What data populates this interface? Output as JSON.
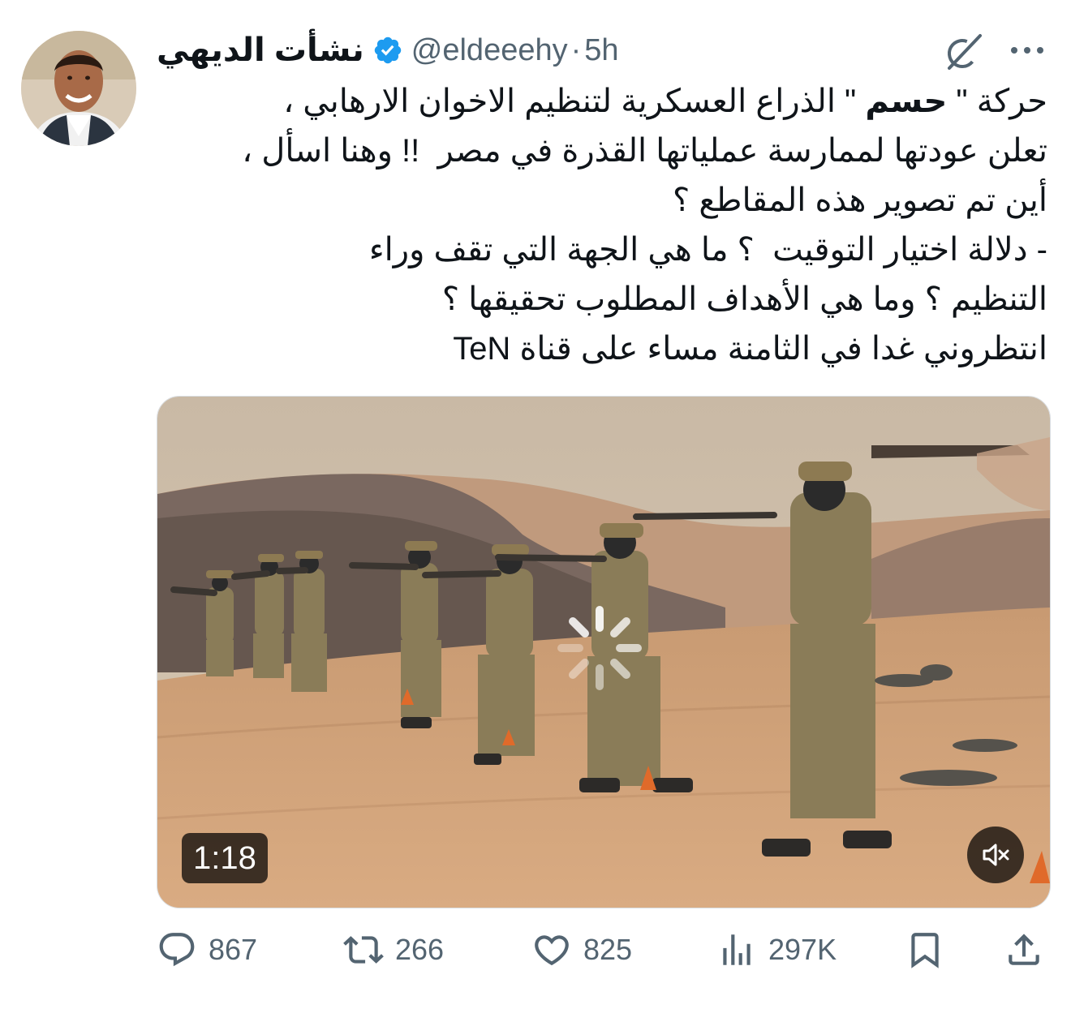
{
  "tweet": {
    "author": {
      "display_name": "نشأت الديهي",
      "handle": "@eldeeehy",
      "verified": true,
      "avatar_icon": "profile-photo"
    },
    "separator": "·",
    "time": "5h",
    "text_lines": {
      "l1_a": "حركة \" ",
      "l1_b": "حسم",
      "l1_c": " \" الذراع العسكرية لتنظيم الاخوان الارهابي ،",
      "l2": "تعلن عودتها لممارسة عملياتها القذرة في مصر  !! وهنا اسأل ،",
      "l3": "أين تم تصوير هذه المقاطع ؟",
      "l4": "- دلالة اختيار التوقيت  ؟ ما هي الجهة التي تقف وراء",
      "l5": "التنظيم ؟ وما هي الأهداف المطلوب تحقيقها ؟",
      "l6": "انتظروني غدا في الثامنة مساء على قناة TeN"
    },
    "media": {
      "type": "video",
      "duration": "1:18",
      "muted": true,
      "loading": true
    },
    "stats": {
      "replies": "867",
      "reposts": "266",
      "likes": "825",
      "views": "297K"
    }
  },
  "colors": {
    "text": "#0f1419",
    "secondary": "#536471",
    "verified_blue": "#1d9bf0"
  }
}
